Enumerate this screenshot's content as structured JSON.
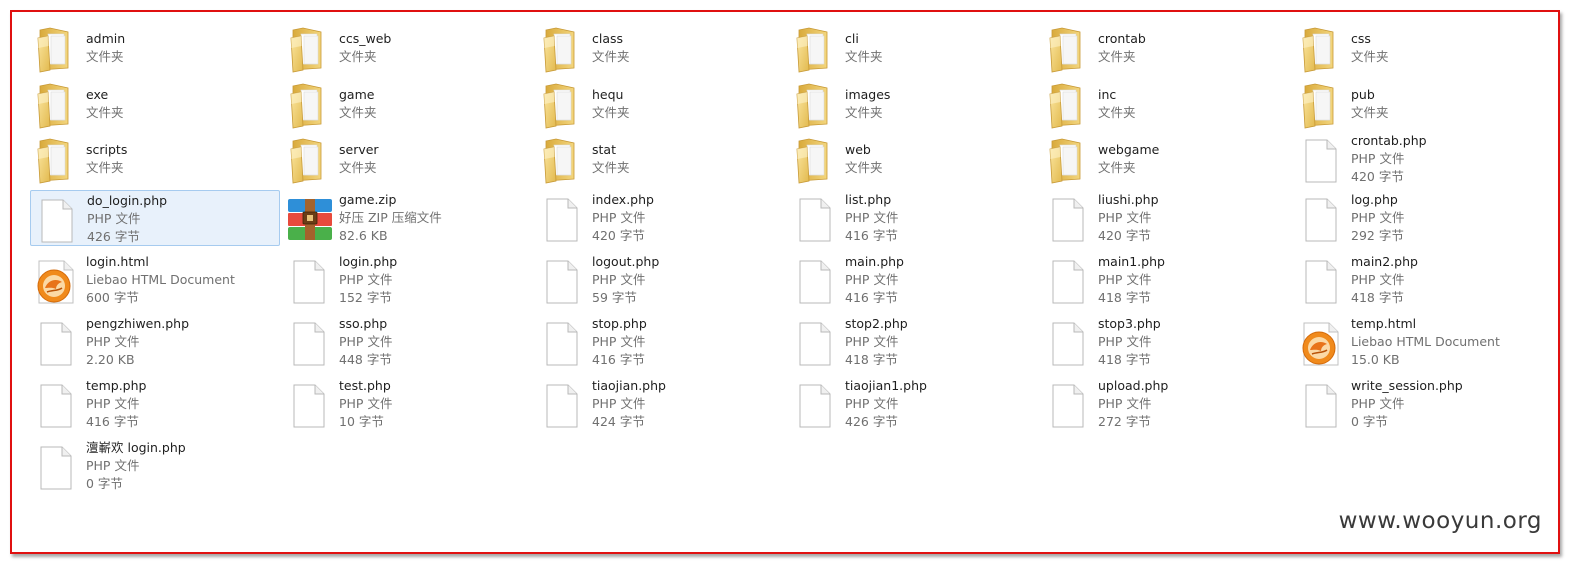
{
  "colors": {
    "frame_border": "#e01010",
    "selection_bg": "#e8f1fb",
    "selection_border": "#a6cbef",
    "subtext": "#707070"
  },
  "watermark": "www.wooyun.org",
  "rows": [
    [
      {
        "name": "admin",
        "type": "文件夹",
        "icon": "folder-icon"
      },
      {
        "name": "ccs_web",
        "type": "文件夹",
        "icon": "folder-icon"
      },
      {
        "name": "class",
        "type": "文件夹",
        "icon": "folder-icon"
      },
      {
        "name": "cli",
        "type": "文件夹",
        "icon": "folder-icon"
      },
      {
        "name": "crontab",
        "type": "文件夹",
        "icon": "folder-icon"
      },
      {
        "name": "css",
        "type": "文件夹",
        "icon": "folder-icon"
      }
    ],
    [
      {
        "name": "exe",
        "type": "文件夹",
        "icon": "folder-icon"
      },
      {
        "name": "game",
        "type": "文件夹",
        "icon": "folder-icon"
      },
      {
        "name": "hequ",
        "type": "文件夹",
        "icon": "folder-icon"
      },
      {
        "name": "images",
        "type": "文件夹",
        "icon": "folder-icon"
      },
      {
        "name": "inc",
        "type": "文件夹",
        "icon": "folder-icon"
      },
      {
        "name": "pub",
        "type": "文件夹",
        "icon": "folder-icon"
      }
    ],
    [
      {
        "name": "scripts",
        "type": "文件夹",
        "icon": "folder-icon"
      },
      {
        "name": "server",
        "type": "文件夹",
        "icon": "folder-icon"
      },
      {
        "name": "stat",
        "type": "文件夹",
        "icon": "folder-icon"
      },
      {
        "name": "web",
        "type": "文件夹",
        "icon": "folder-icon"
      },
      {
        "name": "webgame",
        "type": "文件夹",
        "icon": "folder-icon"
      },
      {
        "name": "crontab.php",
        "type": "PHP 文件",
        "size": "420 字节",
        "icon": "php-file-icon"
      }
    ],
    [
      {
        "name": "do_login.php",
        "type": "PHP 文件",
        "size": "426 字节",
        "icon": "php-file-icon",
        "selected": true
      },
      {
        "name": "game.zip",
        "type": "好压 ZIP 压缩文件",
        "size": "82.6 KB",
        "icon": "zip-archive-icon"
      },
      {
        "name": "index.php",
        "type": "PHP 文件",
        "size": "420 字节",
        "icon": "php-file-icon"
      },
      {
        "name": "list.php",
        "type": "PHP 文件",
        "size": "416 字节",
        "icon": "php-file-icon"
      },
      {
        "name": "liushi.php",
        "type": "PHP 文件",
        "size": "420 字节",
        "icon": "php-file-icon"
      },
      {
        "name": "log.php",
        "type": "PHP 文件",
        "size": "292 字节",
        "icon": "php-file-icon"
      }
    ],
    [
      {
        "name": "login.html",
        "type": "Liebao HTML Document",
        "size": "600 字节",
        "icon": "liebao-html-icon"
      },
      {
        "name": "login.php",
        "type": "PHP 文件",
        "size": "152 字节",
        "icon": "php-file-icon"
      },
      {
        "name": "logout.php",
        "type": "PHP 文件",
        "size": "59 字节",
        "icon": "php-file-icon"
      },
      {
        "name": "main.php",
        "type": "PHP 文件",
        "size": "416 字节",
        "icon": "php-file-icon"
      },
      {
        "name": "main1.php",
        "type": "PHP 文件",
        "size": "418 字节",
        "icon": "php-file-icon"
      },
      {
        "name": "main2.php",
        "type": "PHP 文件",
        "size": "418 字节",
        "icon": "php-file-icon"
      }
    ],
    [
      {
        "name": "pengzhiwen.php",
        "type": "PHP 文件",
        "size": "2.20 KB",
        "icon": "php-file-icon"
      },
      {
        "name": "sso.php",
        "type": "PHP 文件",
        "size": "448 字节",
        "icon": "php-file-icon"
      },
      {
        "name": "stop.php",
        "type": "PHP 文件",
        "size": "416 字节",
        "icon": "php-file-icon"
      },
      {
        "name": "stop2.php",
        "type": "PHP 文件",
        "size": "418 字节",
        "icon": "php-file-icon"
      },
      {
        "name": "stop3.php",
        "type": "PHP 文件",
        "size": "418 字节",
        "icon": "php-file-icon"
      },
      {
        "name": "temp.html",
        "type": "Liebao HTML Document",
        "size": "15.0 KB",
        "icon": "liebao-html-icon"
      }
    ],
    [
      {
        "name": "temp.php",
        "type": "PHP 文件",
        "size": "416 字节",
        "icon": "php-file-icon"
      },
      {
        "name": "test.php",
        "type": "PHP 文件",
        "size": "10 字节",
        "icon": "php-file-icon"
      },
      {
        "name": "tiaojian.php",
        "type": "PHP 文件",
        "size": "424 字节",
        "icon": "php-file-icon"
      },
      {
        "name": "tiaojian1.php",
        "type": "PHP 文件",
        "size": "426 字节",
        "icon": "php-file-icon"
      },
      {
        "name": "upload.php",
        "type": "PHP 文件",
        "size": "272 字节",
        "icon": "php-file-icon"
      },
      {
        "name": "write_session.php",
        "type": "PHP 文件",
        "size": "0 字节",
        "icon": "php-file-icon"
      }
    ],
    [
      {
        "name": "澶嶄欢 login.php",
        "type": "PHP 文件",
        "size": "0 字节",
        "icon": "php-file-icon"
      }
    ]
  ]
}
